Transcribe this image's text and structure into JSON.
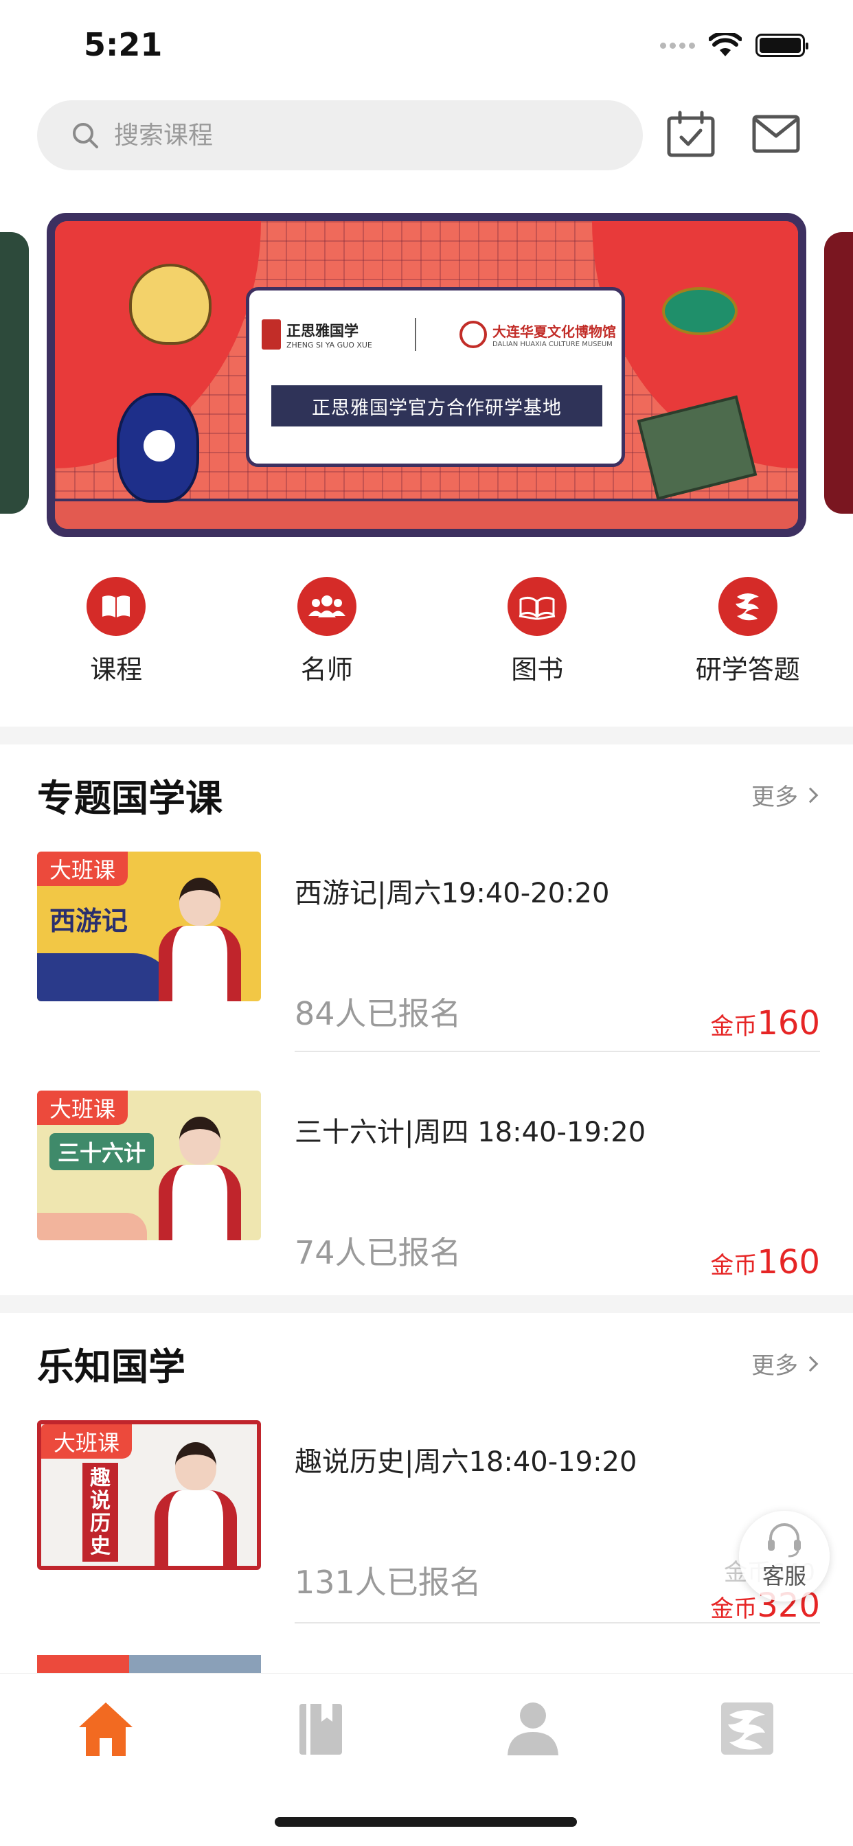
{
  "status_bar": {
    "time": "5:21"
  },
  "header": {
    "search_placeholder": "搜索课程"
  },
  "banner": {
    "logo_left": "正思雅国学",
    "logo_left_sub": "ZHENG SI YA GUO XUE",
    "logo_right": "大连华夏文化博物馆",
    "logo_right_sub": "DALIAN HUAXIA CULTURE MUSEUM",
    "caption": "正思雅国学官方合作研学基地"
  },
  "quick_nav": [
    {
      "label": "课程",
      "icon": "book-open-icon"
    },
    {
      "label": "名师",
      "icon": "group-icon"
    },
    {
      "label": "图书",
      "icon": "open-book-icon"
    },
    {
      "label": "研学答题",
      "icon": "dragon-icon"
    }
  ],
  "sections": [
    {
      "title": "专题国学课",
      "more": "更多",
      "courses": [
        {
          "badge": "大班课",
          "thumb_title": "西游记",
          "title": "西游记|周六19:40-20:20",
          "enrolled": "84人已报名",
          "price_unit": "金币",
          "price": "160"
        },
        {
          "badge": "大班课",
          "thumb_title": "三十六计",
          "title": "三十六计|周四 18:40-19:20",
          "enrolled": "74人已报名",
          "price_unit": "金币",
          "price": "160"
        }
      ]
    },
    {
      "title": "乐知国学",
      "more": "更多",
      "courses": [
        {
          "badge": "大班课",
          "thumb_title": "趣说历史",
          "title": "趣说历史|周六18:40-19:20",
          "enrolled": "131人已报名",
          "price_unit": "金币",
          "price": "320",
          "old_price": "金币640"
        }
      ]
    }
  ],
  "service": {
    "label": "客服"
  },
  "tab_bar": [
    {
      "name": "home",
      "icon": "home-icon",
      "active": true
    },
    {
      "name": "library",
      "icon": "library-icon",
      "active": false
    },
    {
      "name": "profile",
      "icon": "person-icon",
      "active": false
    },
    {
      "name": "dragon",
      "icon": "dragon-icon",
      "active": false
    }
  ],
  "colors": {
    "accent": "#e62525",
    "badge": "#ec4a3c",
    "active_tab": "#f26a21",
    "inactive_tab": "#c4c4c4"
  }
}
